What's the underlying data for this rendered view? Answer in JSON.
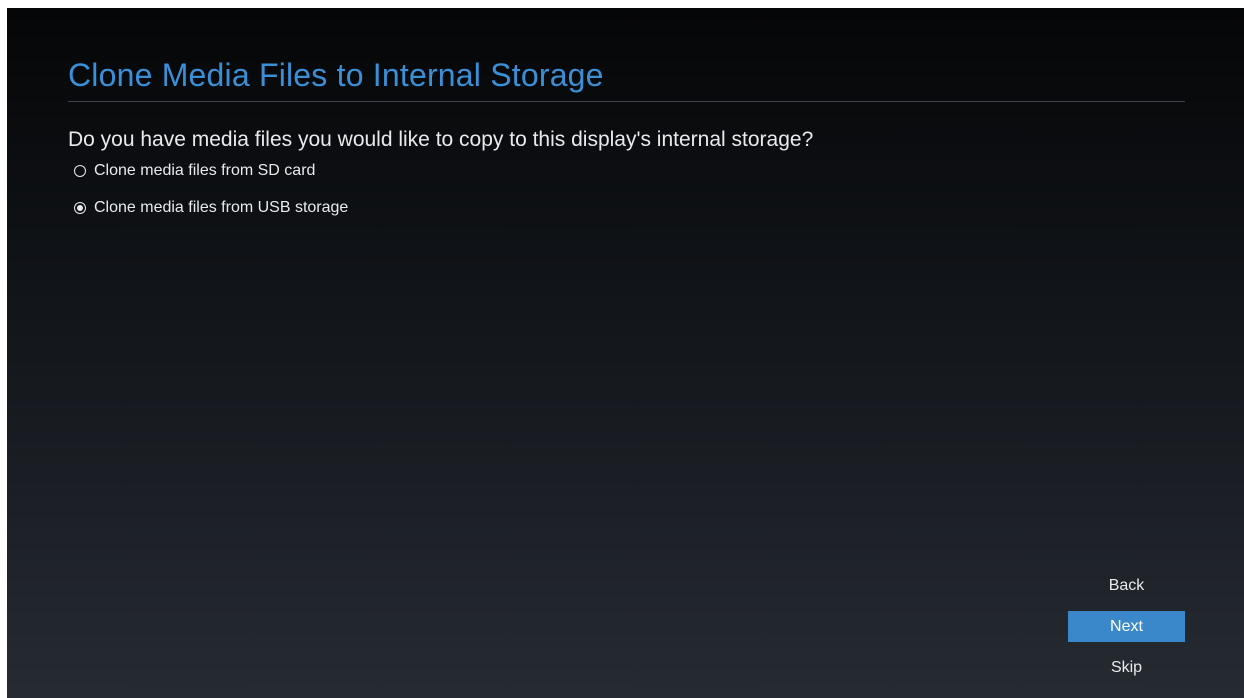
{
  "header": {
    "title": "Clone Media Files to Internal Storage"
  },
  "main": {
    "question": "Do you have media files you would like to copy to this display's internal storage?",
    "options": [
      {
        "label": "Clone media files from SD card",
        "selected": false
      },
      {
        "label": "Clone media files from USB storage",
        "selected": true
      }
    ]
  },
  "nav": {
    "back_label": "Back",
    "next_label": "Next",
    "skip_label": "Skip"
  },
  "colors": {
    "accent": "#3a8fd6",
    "button_highlight": "#3a87c9",
    "text": "#e8eaec"
  }
}
